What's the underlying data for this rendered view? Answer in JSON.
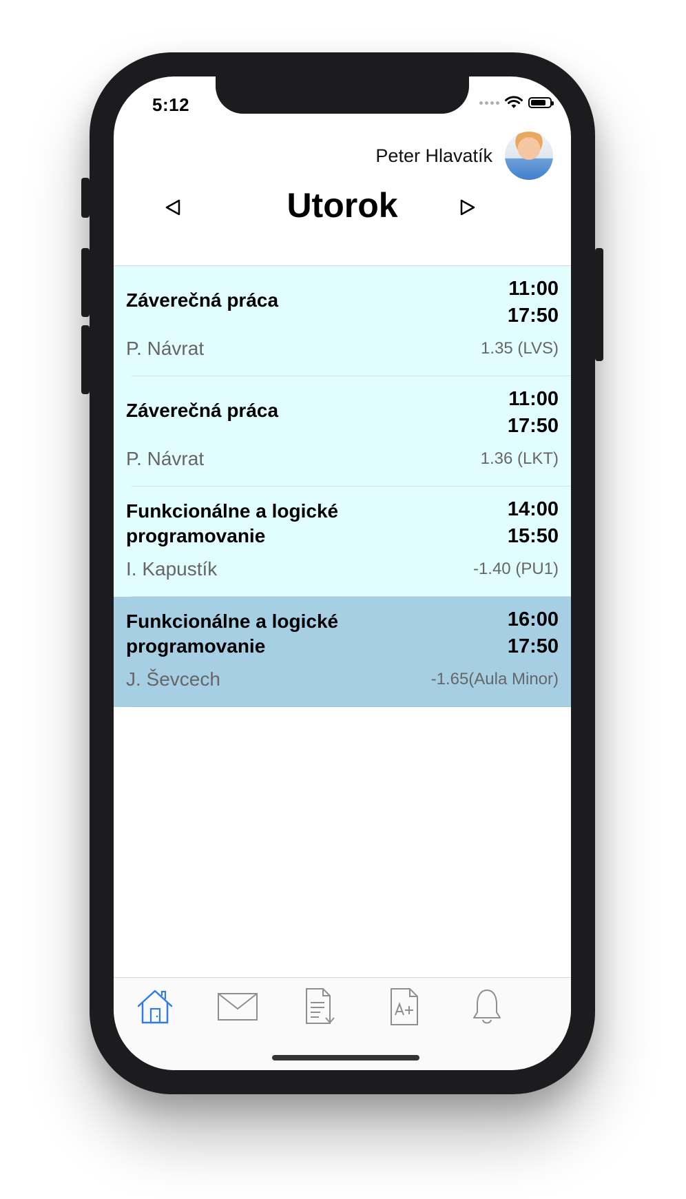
{
  "status_bar": {
    "time": "5:12"
  },
  "header": {
    "user_name": "Peter Hlavatík"
  },
  "day_nav": {
    "title": "Utorok"
  },
  "lessons": [
    {
      "subject": "Záverečná práca",
      "start": "11:00",
      "end": "17:50",
      "teacher": "P. Návrat",
      "room": "1.35 (LVS)",
      "selected": false
    },
    {
      "subject": "Záverečná práca",
      "start": "11:00",
      "end": "17:50",
      "teacher": "P. Návrat",
      "room": "1.36 (LKT)",
      "selected": false
    },
    {
      "subject": "Funkcionálne a logické programovanie",
      "start": "14:00",
      "end": "15:50",
      "teacher": "I. Kapustík",
      "room": "-1.40 (PU1)",
      "selected": false
    },
    {
      "subject": "Funkcionálne a logické programovanie",
      "start": "16:00",
      "end": "17:50",
      "teacher": "J. Ševcech",
      "room": "-1.65(Aula Minor)",
      "selected": true
    }
  ],
  "tabbar": {
    "tabs": [
      {
        "icon": "home-icon",
        "active": true
      },
      {
        "icon": "mail-icon",
        "active": false
      },
      {
        "icon": "document-download-icon",
        "active": false
      },
      {
        "icon": "grade-document-icon",
        "active": false
      },
      {
        "icon": "bell-icon",
        "active": false
      }
    ]
  },
  "colors": {
    "row_background": "#e2fdfe",
    "row_selected": "#a6cfe3",
    "tab_active": "#2f7de1",
    "tab_inactive": "#8e8e8e"
  }
}
